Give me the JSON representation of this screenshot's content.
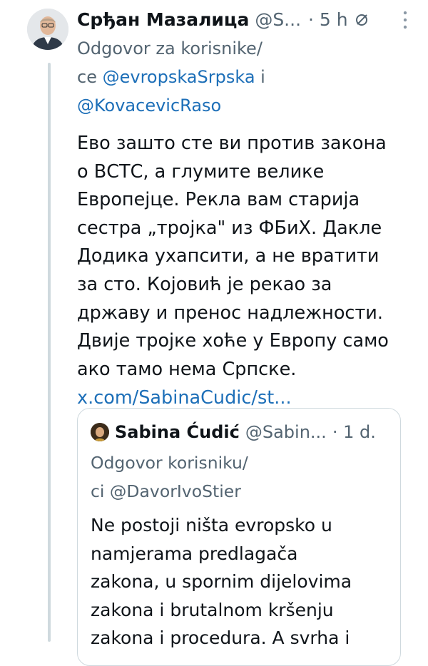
{
  "tweet": {
    "author_name": "Срђан Мазалица",
    "handle": "@S...",
    "time": "· 5 h",
    "reply_prefix": "Odgovor za korisnike/",
    "reply_line2_prefix": "ce ",
    "mention1": "@evropskaSrpska",
    "reply_and": " i",
    "mention2": "@KovacevicRaso",
    "body": "Ево зашто сте ви против закона\nо ВСТС, а глумите велике\nЕвропејце. Рекла вам старија\nсестра „тројка\" из ФБиХ. Дакле\nДодика ухапсити, а не вратити\nза сто. Којовић је рекао за\nдржаву и пренос надлежности.\nДвије тројке хоће у Европу само\nако тамо нема Српске.",
    "link": "x.com/SabinaCudic/st..."
  },
  "quote": {
    "author_name": "Sabina Ćudić",
    "handle": "@Sabin...",
    "time": "· 1 d.",
    "reply_prefix": "Odgovor korisniku/",
    "reply_line2_prefix": "ci ",
    "mention": "@DavorIvoStier",
    "body": "Ne postoji ništa evropsko u\nnamjerama predlagača\nzakona, u spornim dijelovima\nzakona i brutalnom kršenju\nzakona i procedura. A svrha i"
  },
  "icons": {
    "grok": "slashed-circle-icon",
    "more": "vertical-dots-icon"
  },
  "colors": {
    "text": "#0f1419",
    "muted": "#536471",
    "link": "#1d6fb8",
    "border": "#cfd9de"
  }
}
